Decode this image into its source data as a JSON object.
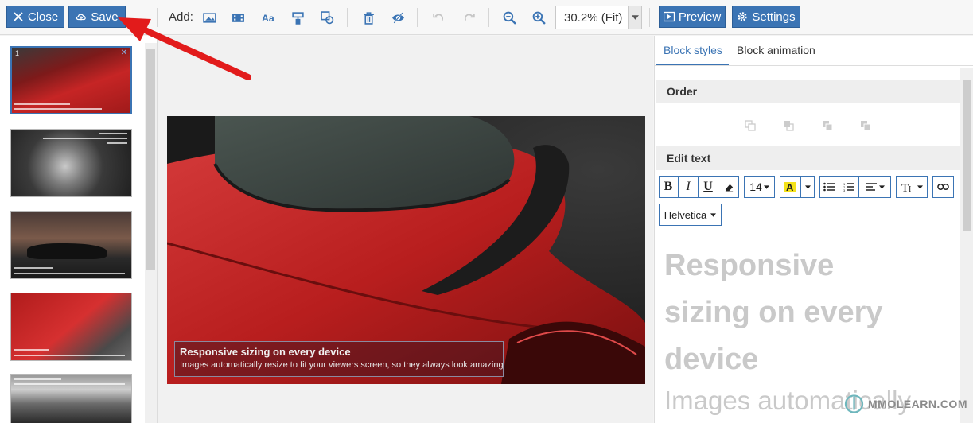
{
  "toolbar": {
    "close_label": "Close",
    "save_label": "Save",
    "add_label": "Add:",
    "add_tools": [
      "image-icon",
      "video-icon",
      "text-icon",
      "paint-icon",
      "shapes-icon"
    ],
    "edit_tools": [
      "trash-icon",
      "hide-icon"
    ],
    "history_tools": [
      "undo-icon",
      "redo-icon"
    ],
    "zoom_value": "30.2% (Fit)",
    "preview_label": "Preview",
    "settings_label": "Settings",
    "accent_color": "#3b74b4"
  },
  "thumbnails": {
    "count": 5,
    "active_index": 0,
    "first_number": "1"
  },
  "slide": {
    "caption_title": "Responsive sizing on every device",
    "caption_body": "Images automatically resize to fit your viewers screen, so they always look amazing"
  },
  "right_panel": {
    "tabs": [
      "Block styles",
      "Block animation"
    ],
    "active_tab": 0,
    "order_heading": "Order",
    "edit_text_heading": "Edit text",
    "font_size": "14",
    "font_family": "Helvetica",
    "preview_line1": "Responsive",
    "preview_line2": "sizing on every",
    "preview_line3": "device",
    "preview_body": "Images automatically"
  },
  "watermark": {
    "text": "MMOLEARN.COM"
  }
}
